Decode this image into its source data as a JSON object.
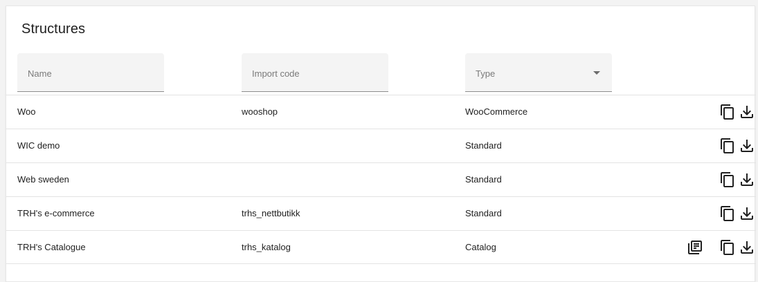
{
  "page": {
    "title": "Structures"
  },
  "filters": {
    "name_label": "Name",
    "code_label": "Import code",
    "type_label": "Type"
  },
  "rows": [
    {
      "name": "Woo",
      "code": "wooshop",
      "type": "WooCommerce",
      "icons": [
        "copy-icon",
        "download-icon"
      ]
    },
    {
      "name": "WIC demo",
      "code": "",
      "type": "Standard",
      "icons": [
        "copy-icon",
        "download-icon"
      ]
    },
    {
      "name": "Web sweden",
      "code": "",
      "type": "Standard",
      "icons": [
        "copy-icon",
        "download-icon"
      ]
    },
    {
      "name": "TRH's e-commerce",
      "code": "trhs_nettbutikk",
      "type": "Standard",
      "icons": [
        "copy-icon",
        "download-icon"
      ]
    },
    {
      "name": "TRH's Catalogue",
      "code": "trhs_katalog",
      "type": "Catalog",
      "icons": [
        "catalog-icon",
        "copy-icon",
        "download-icon"
      ]
    }
  ]
}
